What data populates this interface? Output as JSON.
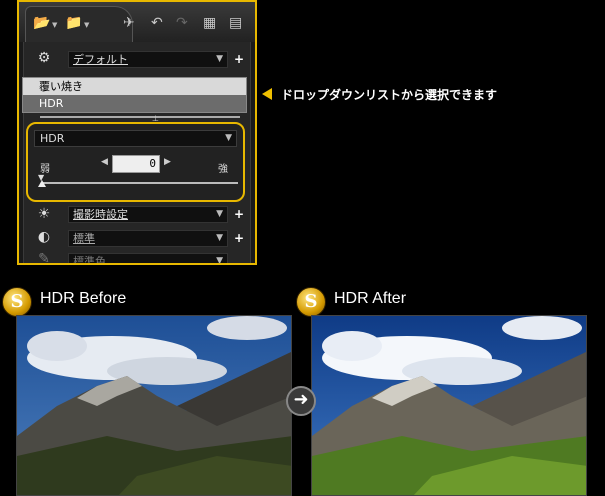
{
  "panel": {
    "preset_select": {
      "value": "デフォルト",
      "icon": "gear-icon"
    },
    "dropdown_options": [
      "覆い焼き",
      "HDR"
    ],
    "hdr_control": {
      "mode_value": "HDR",
      "strength_value": "0",
      "weak_label": "弱",
      "strong_label": "強",
      "strength_level_fraction": 0
    },
    "shooting_select": {
      "value": "撮影時設定",
      "icon": "brightness-icon"
    },
    "picture_style_select": {
      "value": "標準",
      "icon": "contrast-icon"
    },
    "color_select": {
      "value": "標準色",
      "icon": "dropper-icon"
    }
  },
  "callout": {
    "text": "ドロップダウンリストから選択できます"
  },
  "comparison": {
    "before_title": "HDR Before",
    "after_title": "HDR After"
  },
  "colors": {
    "accent": "#e8b800"
  }
}
